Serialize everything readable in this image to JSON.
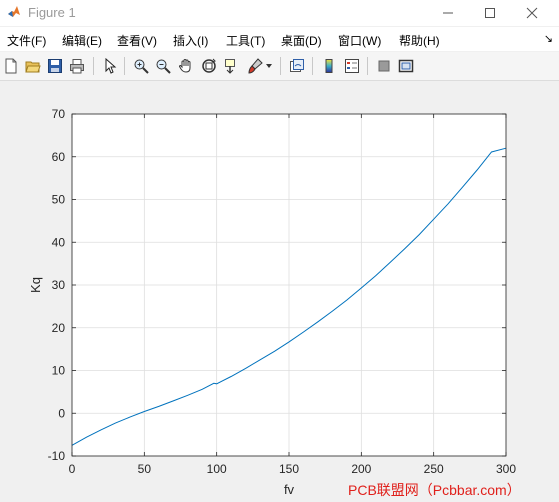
{
  "window": {
    "title": "Figure 1",
    "accent_color": "#0072bd"
  },
  "menu": {
    "items": [
      "文件(F)",
      "编辑(E)",
      "查看(V)",
      "插入(I)",
      "工具(T)",
      "桌面(D)",
      "窗口(W)",
      "帮助(H)"
    ]
  },
  "toolbar": {
    "icons": [
      "new-figure-icon",
      "open-file-icon",
      "save-icon",
      "print-icon",
      "edit-plot-arrow-icon",
      "zoom-in-icon",
      "zoom-out-icon",
      "pan-hand-icon",
      "rotate-3d-icon",
      "data-cursor-icon",
      "brush-icon",
      "brush-dropdown-icon",
      "link-plot-icon",
      "colorbar-icon",
      "legend-icon",
      "hide-plot-tools-icon",
      "show-plot-tools-icon"
    ]
  },
  "chart_data": {
    "type": "line",
    "title": "",
    "xlabel": "fv",
    "ylabel": "Kq",
    "xlim": [
      0,
      300
    ],
    "ylim": [
      -10,
      70
    ],
    "xticks": [
      0,
      50,
      100,
      150,
      200,
      250,
      300
    ],
    "yticks": [
      -10,
      0,
      10,
      20,
      30,
      40,
      50,
      60,
      70
    ],
    "grid": true,
    "series": [
      {
        "color": "#0072bd",
        "x": [
          0,
          10,
          20,
          30,
          40,
          50,
          60,
          70,
          80,
          90,
          98,
          100,
          110,
          120,
          130,
          140,
          150,
          160,
          170,
          180,
          190,
          200,
          210,
          220,
          230,
          240,
          250,
          260,
          270,
          280,
          290,
          300
        ],
        "y": [
          -7.5,
          -5.6,
          -3.9,
          -2.3,
          -0.9,
          0.4,
          1.6,
          2.9,
          4.2,
          5.6,
          7.0,
          6.9,
          8.6,
          10.5,
          12.5,
          14.5,
          16.7,
          19.0,
          21.4,
          23.9,
          26.5,
          29.3,
          32.2,
          35.3,
          38.5,
          41.8,
          45.4,
          49.0,
          52.9,
          56.9,
          61.1,
          62.0
        ]
      }
    ]
  },
  "watermark": "PCB联盟网（Pcbbar.com）"
}
